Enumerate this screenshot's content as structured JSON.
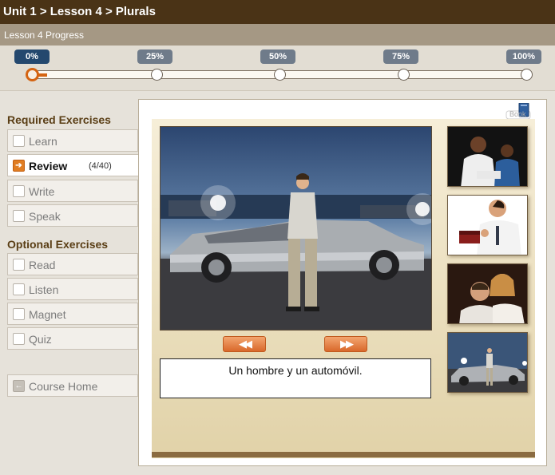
{
  "header": {
    "breadcrumb": "Unit 1 > Lesson 4 > Plurals"
  },
  "progress": {
    "label": "Lesson 4 Progress",
    "value": 0.03,
    "milestones": [
      "0%",
      "25%",
      "50%",
      "75%",
      "100%"
    ],
    "active_milestone": "0%",
    "accent_color": "#d46412"
  },
  "sidebar": {
    "required_title": "Required Exercises",
    "required_items": [
      {
        "label": "Learn"
      },
      {
        "label": "Review",
        "count": "(4/40)",
        "selected": true
      },
      {
        "label": "Write"
      },
      {
        "label": "Speak"
      }
    ],
    "optional_title": "Optional Exercises",
    "optional_items": [
      {
        "label": "Read"
      },
      {
        "label": "Listen"
      },
      {
        "label": "Magnet"
      },
      {
        "label": "Quiz"
      }
    ],
    "home_label": "Course Home"
  },
  "content": {
    "book_label": "Book",
    "caption": "Un hombre y un automóvil.",
    "prev_icon": "rewind-icon",
    "next_icon": "fast-forward-icon",
    "thumbnails": [
      "two-people-photo",
      "man-with-gift-photo",
      "couple-embracing-photo",
      "man-with-car-photo"
    ]
  }
}
